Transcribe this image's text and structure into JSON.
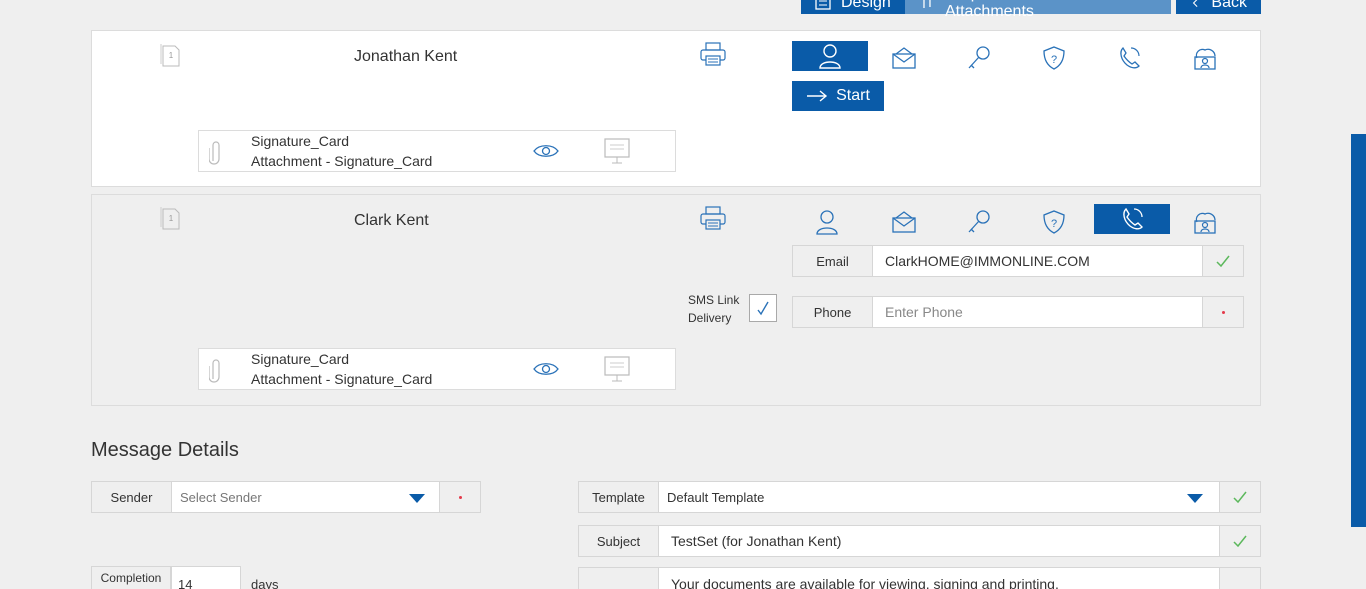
{
  "topbar": {
    "design_label": "Design",
    "request_label": "Request Remote Attachments",
    "back_label": "Back"
  },
  "signers": [
    {
      "name": "Jonathan Kent",
      "order": "1",
      "start_label": "Start",
      "attachment": {
        "title": "Signature_Card",
        "subtitle": "Attachment - Signature_Card"
      }
    },
    {
      "name": "Clark Kent",
      "order": "1",
      "email_label": "Email",
      "email_value": "ClarkHOME@IMMONLINE.COM",
      "sms_label_1": "SMS Link",
      "sms_label_2": "Delivery",
      "phone_label": "Phone",
      "phone_placeholder": "Enter Phone",
      "attachment": {
        "title": "Signature_Card",
        "subtitle": "Attachment - Signature_Card"
      }
    }
  ],
  "delivery_methods": [
    "person-icon",
    "envelope-icon",
    "key-icon",
    "shield-question-icon",
    "phone-icon",
    "cloud-person-icon"
  ],
  "message": {
    "title": "Message Details",
    "sender_label": "Sender",
    "sender_placeholder": "Select Sender",
    "template_label": "Template",
    "template_value": "Default Template",
    "subject_label": "Subject",
    "subject_value": "TestSet (for Jonathan Kent)",
    "completion_label": "Completion",
    "completion_value": "14",
    "completion_unit": "days",
    "body_value": "Your documents are available for viewing, signing and printing."
  },
  "colors": {
    "primary": "#0a5ba8",
    "light_primary": "#5b93c8",
    "check": "#5cb85c",
    "required": "#e4394a"
  }
}
